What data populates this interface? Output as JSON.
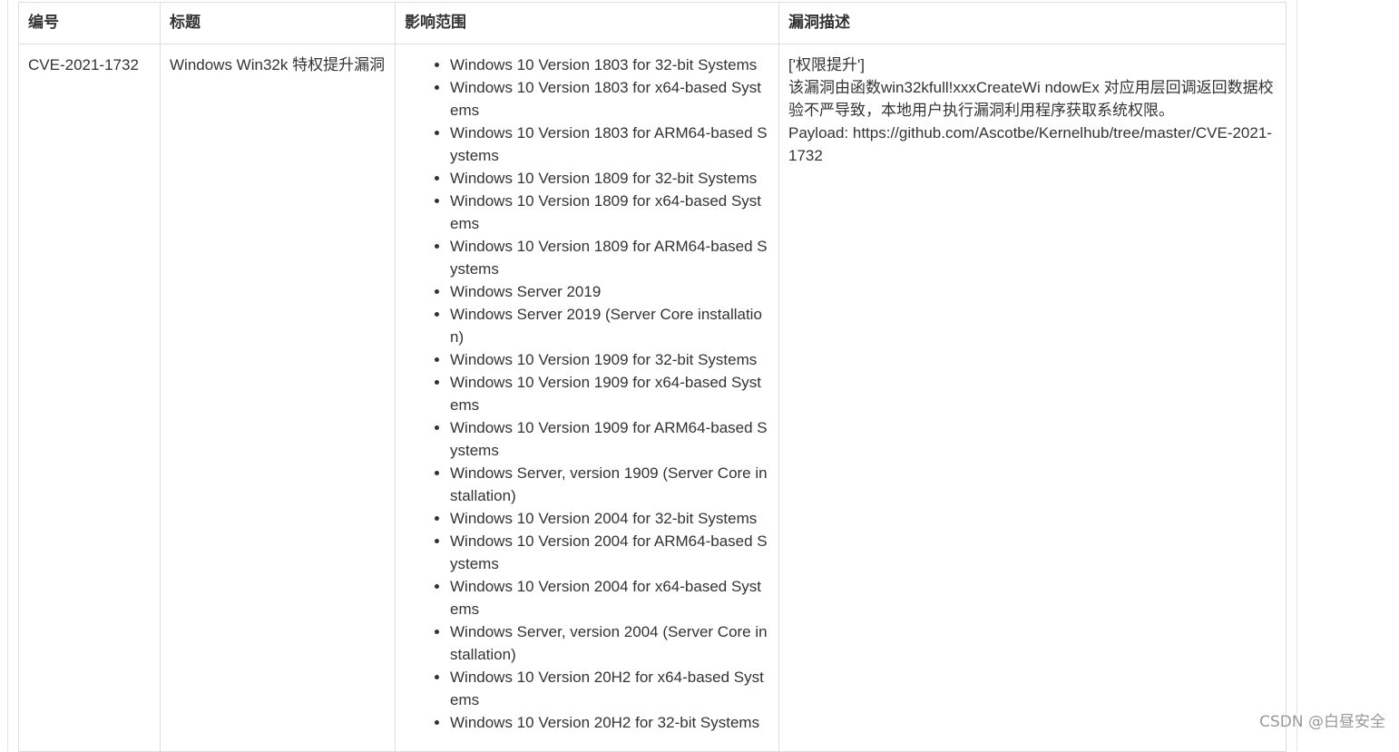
{
  "table": {
    "headers": [
      "编号",
      "标题",
      "影响范围",
      "漏洞描述"
    ],
    "row": {
      "id": "CVE-2021-1732",
      "title": "Windows Win32k 特权提升漏洞",
      "affected": [
        "Windows 10 Version 1803 for 32-bit Systems",
        "Windows 10 Version 1803 for x64-based Systems",
        "Windows 10 Version 1803 for ARM64-based Systems",
        "Windows 10 Version 1809 for 32-bit Systems",
        "Windows 10 Version 1809 for x64-based Systems",
        "Windows 10 Version 1809 for ARM64-based Systems",
        "Windows Server 2019",
        "Windows Server 2019 (Server Core installation)",
        "Windows 10 Version 1909 for 32-bit Systems",
        "Windows 10 Version 1909 for x64-based Systems",
        "Windows 10 Version 1909 for ARM64-based Systems",
        "Windows Server, version 1909 (Server Core installation)",
        "Windows 10 Version 2004 for 32-bit Systems",
        "Windows 10 Version 2004 for ARM64-based Systems",
        "Windows 10 Version 2004 for x64-based Systems",
        "Windows Server, version 2004 (Server Core installation)",
        "Windows 10 Version 20H2 for x64-based Systems",
        "Windows 10 Version 20H2 for 32-bit Systems"
      ],
      "description": {
        "tag": "['权限提升']",
        "text": "该漏洞由函数win32kfull!xxxCreateWi ndowEx 对应用层回调返回数据校验不严导致，本地用户执行漏洞利用程序获取系统权限。",
        "payload": "Payload: https://github.com/Ascotbe/Kernelhub/tree/master/CVE-2021-1732"
      }
    }
  },
  "watermark": "CSDN @白昼安全"
}
